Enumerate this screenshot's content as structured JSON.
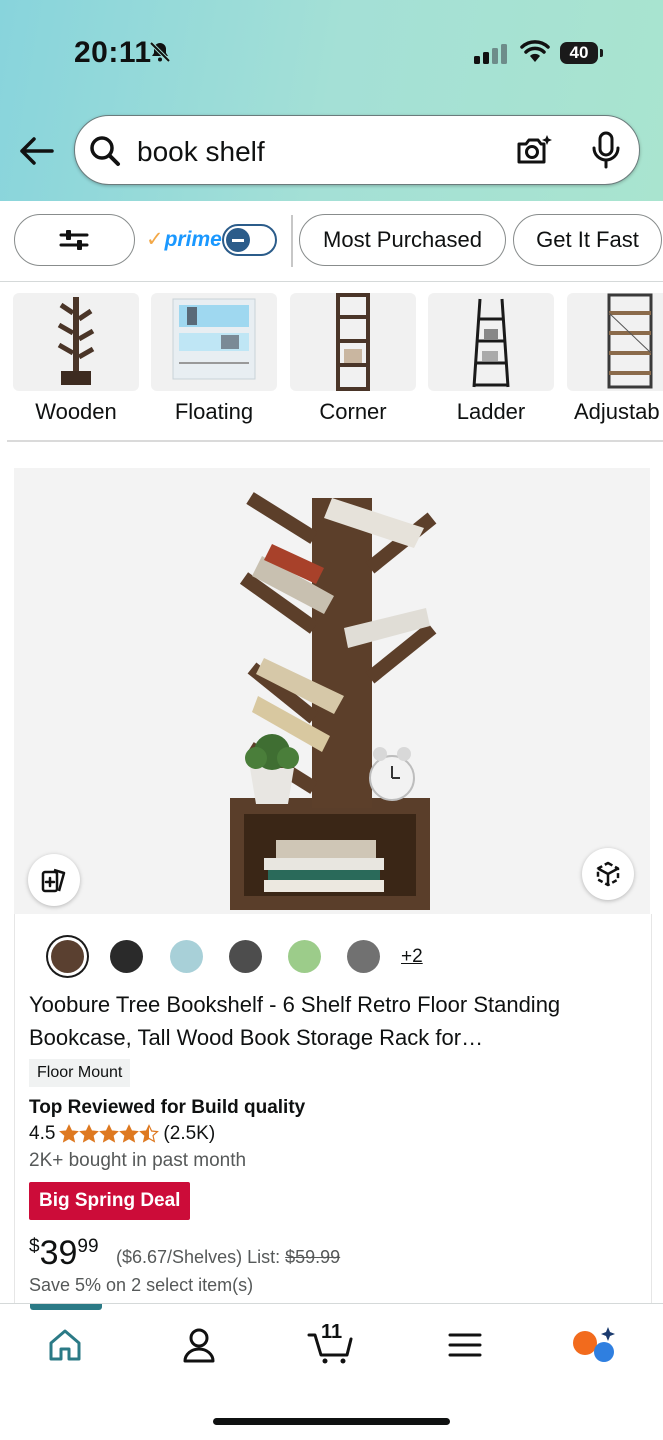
{
  "status_bar": {
    "time": "20:11",
    "battery": "40"
  },
  "search": {
    "query": "book shelf"
  },
  "filters": {
    "prime_label": "prime",
    "chips": [
      "Most Purchased",
      "Get It Fast"
    ]
  },
  "categories": [
    {
      "label": "Wooden"
    },
    {
      "label": "Floating"
    },
    {
      "label": "Corner"
    },
    {
      "label": "Ladder"
    },
    {
      "label": "Adjustab"
    }
  ],
  "product": {
    "swatch_colors": [
      "#5a4030",
      "#2a2a2a",
      "#a8d0d8",
      "#4d4d4d",
      "#9ccc8a",
      "#717171"
    ],
    "more_colors": "+2",
    "title": "Yoobure Tree Bookshelf - 6 Shelf Retro Floor Standing Bookcase, Tall Wood Book Storage Rack for…",
    "badge": "Floor Mount",
    "top_reviewed": "Top Reviewed for Build quality",
    "rating": "4.5",
    "rating_stars": 4.5,
    "review_count": "(2.5K)",
    "bought": "2K+ bought in past month",
    "deal": "Big Spring Deal",
    "price_symbol": "$",
    "price_whole": "39",
    "price_fraction": "99",
    "unit_price": "($6.67/Shelves)",
    "list_label": "List:",
    "list_price": "$59.99",
    "save_text": "Save 5% on 2 select item(s)"
  },
  "bottom_nav": {
    "cart_count": "11"
  },
  "colors": {
    "accent": "#2b7a86",
    "deal_red": "#cc0c39",
    "star": "#de7921",
    "prime_blue": "#1a98ff"
  }
}
